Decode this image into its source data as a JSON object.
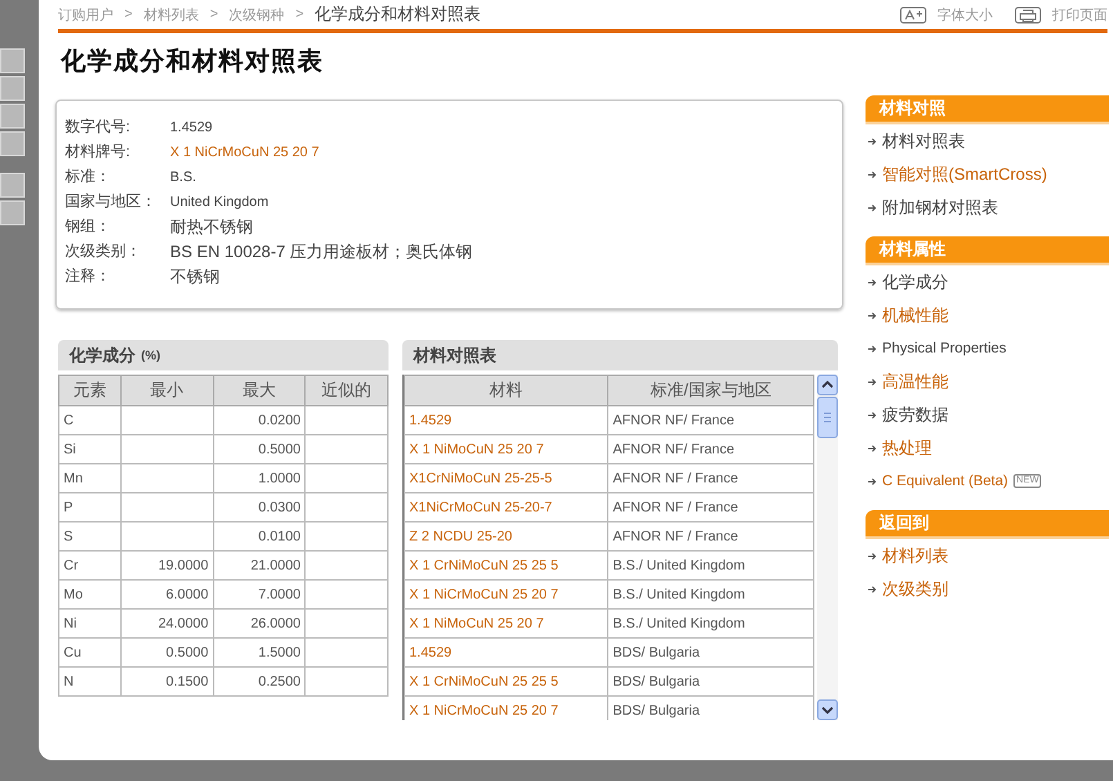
{
  "breadcrumb_separator": ">",
  "breadcrumb": [
    {
      "label": "订购用户",
      "current": false
    },
    {
      "label": "材料列表",
      "current": false
    },
    {
      "label": "次级钢种",
      "current": false
    },
    {
      "label": "化学成分和材料对照表",
      "current": true
    }
  ],
  "tools": [
    {
      "kind": "font",
      "label": "字体大小"
    },
    {
      "kind": "print",
      "label": "打印页面"
    }
  ],
  "title": "化学成分和材料对照表",
  "info": [
    {
      "label": "数字代号:",
      "value": "1.4529",
      "link": false
    },
    {
      "label": "材料牌号:",
      "value": "X 1 NiCrMoCuN 25 20 7",
      "link": true
    },
    {
      "label": "标准：",
      "value": "B.S.",
      "link": false
    },
    {
      "label": "国家与地区：",
      "value": "United Kingdom",
      "link": false
    },
    {
      "label": "钢组：",
      "value": "耐热不锈钢",
      "link": false
    },
    {
      "label": "次级类别：",
      "value": "BS EN 10028-7 压力用途板材；奥氏体钢",
      "link": false
    },
    {
      "label": "注释：",
      "value": "不锈钢",
      "link": false
    }
  ],
  "chemistry": {
    "title": "化学成分",
    "unit": "(%)",
    "columns": [
      "元素",
      "最小",
      "最大",
      "近似的"
    ],
    "rows": [
      [
        "C",
        "",
        "0.0200",
        ""
      ],
      [
        "Si",
        "",
        "0.5000",
        ""
      ],
      [
        "Mn",
        "",
        "1.0000",
        ""
      ],
      [
        "P",
        "",
        "0.0300",
        ""
      ],
      [
        "S",
        "",
        "0.0100",
        ""
      ],
      [
        "Cr",
        "19.0000",
        "21.0000",
        ""
      ],
      [
        "Mo",
        "6.0000",
        "7.0000",
        ""
      ],
      [
        "Ni",
        "24.0000",
        "26.0000",
        ""
      ],
      [
        "Cu",
        "0.5000",
        "1.5000",
        ""
      ],
      [
        "N",
        "0.1500",
        "0.2500",
        ""
      ]
    ]
  },
  "cross": {
    "title": "材料对照表",
    "columns": [
      "材料",
      "标准/国家与地区"
    ],
    "rows": [
      [
        "1.4529",
        "AFNOR NF/ France"
      ],
      [
        "X 1 NiMoCuN 25 20 7",
        "AFNOR NF/ France"
      ],
      [
        "X1CrNiMoCuN 25-25-5",
        "AFNOR NF / France"
      ],
      [
        "X1NiCrMoCuN 25-20-7",
        "AFNOR NF / France"
      ],
      [
        "Z 2 NCDU 25-20",
        "AFNOR NF / France"
      ],
      [
        "X 1 CrNiMoCuN 25 25 5",
        "B.S./ United Kingdom"
      ],
      [
        "X 1 NiCrMoCuN 25 20 7",
        "B.S./ United Kingdom"
      ],
      [
        "X 1 NiMoCuN 25 20 7",
        "B.S./ United Kingdom"
      ],
      [
        "1.4529",
        "BDS/ Bulgaria"
      ],
      [
        "X 1 CrNiMoCuN 25 25 5",
        "BDS/ Bulgaria"
      ],
      [
        "X 1 NiCrMoCuN 25 20 7",
        "BDS/ Bulgaria"
      ]
    ]
  },
  "sidebar": [
    {
      "title": "材料对照",
      "items": [
        {
          "label": "材料对照表",
          "link": false
        },
        {
          "label": "智能对照(SmartCross)",
          "link": true
        },
        {
          "label": "附加钢材对照表",
          "link": false
        }
      ]
    },
    {
      "title": "材料属性",
      "items": [
        {
          "label": "化学成分",
          "link": false
        },
        {
          "label": "机械性能",
          "link": true
        },
        {
          "label": "Physical Properties",
          "link": false
        },
        {
          "label": "高温性能",
          "link": true
        },
        {
          "label": "疲劳数据",
          "link": false
        },
        {
          "label": "热处理",
          "link": true
        },
        {
          "label": "C Equivalent (Beta)",
          "link": true,
          "badge": "NEW"
        }
      ]
    },
    {
      "title": "返回到",
      "items": [
        {
          "label": "材料列表",
          "link": true
        },
        {
          "label": "次级类别",
          "link": true
        }
      ]
    }
  ]
}
